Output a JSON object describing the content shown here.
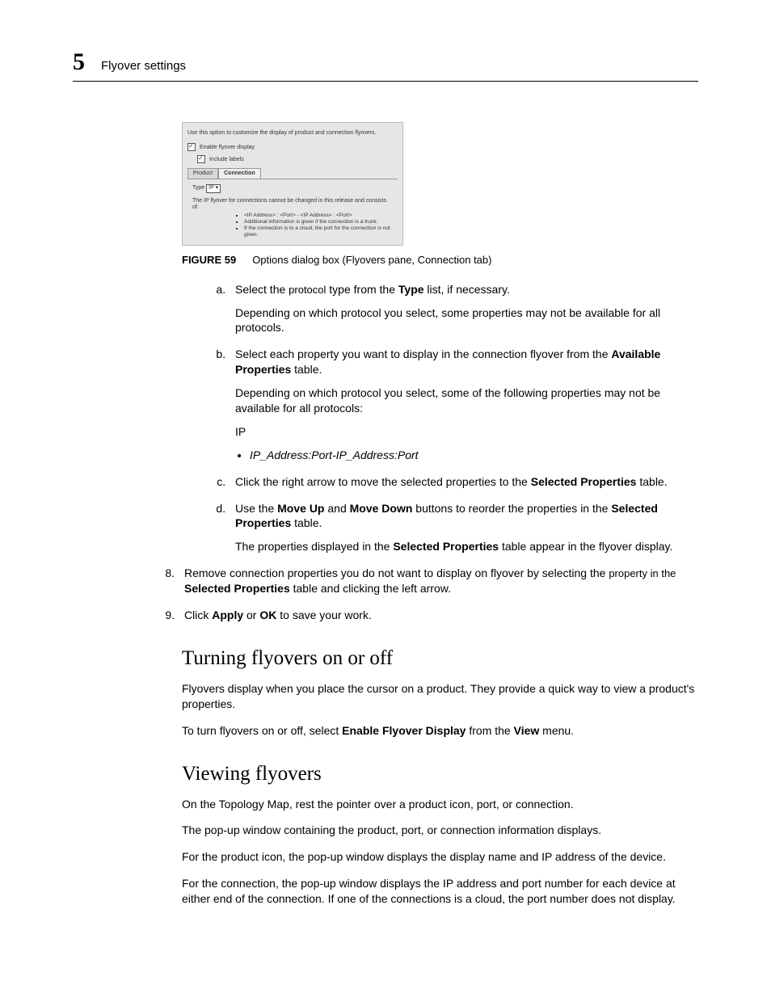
{
  "header": {
    "chapter_number": "5",
    "chapter_title": "Flyover settings"
  },
  "screenshot": {
    "intro": "Use this option to customize the display of product and connection flyovers.",
    "enable_label": "Enable flyover display",
    "include_label": "Include labels",
    "tab_product": "Product",
    "tab_connection": "Connection",
    "type_label": "Type",
    "type_value": "IP ▾",
    "note": "The IP flyover for connections cannot be changed in this release and consists of:",
    "b1": "<IP Address> : <Port> - <IP Address> : <Port>",
    "b2": "Additional information is given if the connection is a trunk.",
    "b3": "If the connection is to a cloud, the port for the connection is not given."
  },
  "figure": {
    "label": "FIGURE 59",
    "caption": "Options dialog box (Flyovers pane, Connection tab)"
  },
  "steps_alpha": {
    "a": {
      "prefix": "Select the ",
      "mono": "protocol",
      "mid": " type from the ",
      "bold": "Type",
      "suffix": " list, if necessary.",
      "note": "Depending on which protocol you select, some properties may not be available for all protocols."
    },
    "b": {
      "prefix": "Select each property you want to display in the connection flyover from the ",
      "bold": "Available Properties",
      "suffix": " table.",
      "note": "Depending on which protocol you select, some of the following properties may not be available for all protocols:",
      "ip": "IP",
      "bullet": "IP_Address:Port-IP_Address:Port"
    },
    "c": {
      "prefix": "Click the right arrow to move the selected properties to the ",
      "bold": "Selected Properties",
      "suffix": " table."
    },
    "d": {
      "prefix": "Use the ",
      "b1": "Move Up",
      "mid1": " and ",
      "b2": "Move Down",
      "mid2": " buttons to reorder the properties in the ",
      "b3": "Selected Properties",
      "suffix": " table.",
      "note_pre": "The properties displayed in the ",
      "note_bold": "Selected Properties",
      "note_suf": " table appear in the flyover display."
    }
  },
  "steps_num": {
    "s8": {
      "prefix": "Remove connection properties you do not want to display on flyover by selecting the ",
      "mono": "property in the ",
      "bold": "Selected Properties",
      "suffix": " table and clicking the left arrow."
    },
    "s9": {
      "prefix": "Click ",
      "b1": "Apply",
      "mid": " or ",
      "b2": "OK",
      "suffix": " to save your work."
    }
  },
  "section1": {
    "title": "Turning flyovers on or off",
    "p1": "Flyovers display when you place the cursor on a product. They provide a quick way to view a product's properties.",
    "p2_pre": "To turn flyovers on or off, select ",
    "p2_b1": "Enable Flyover Display",
    "p2_mid": " from the ",
    "p2_b2": "View",
    "p2_suf": " menu."
  },
  "section2": {
    "title": "Viewing flyovers",
    "p1": "On the Topology Map, rest the pointer over a product icon, port, or connection.",
    "p2": "The pop-up window containing the product, port, or connection information displays.",
    "p3": "For the product icon, the pop-up window displays the display name and IP address of the device.",
    "p4": "For the connection, the pop-up window displays the IP address and port number for each device at either end of the connection. If one of the connections is a cloud, the port number does not display."
  }
}
